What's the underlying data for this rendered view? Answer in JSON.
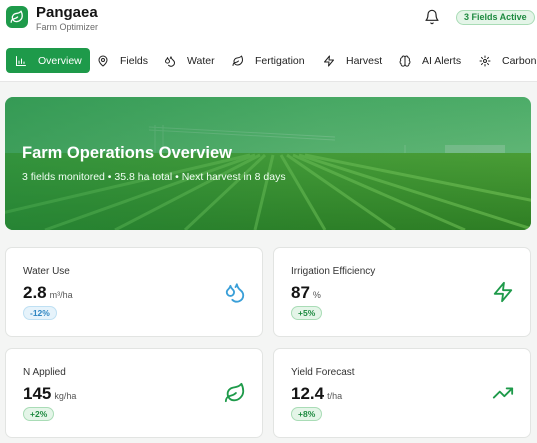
{
  "app": {
    "name": "Pangaea",
    "subtitle": "Farm Optimizer",
    "status_badge": "3 Fields Active"
  },
  "nav": {
    "items": [
      {
        "label": "Overview",
        "icon": "bar-chart-icon",
        "active": true
      },
      {
        "label": "Fields",
        "icon": "map-pin-icon"
      },
      {
        "label": "Water",
        "icon": "droplets-icon"
      },
      {
        "label": "Fertigation",
        "icon": "leaf-icon"
      },
      {
        "label": "Harvest",
        "icon": "lightning-icon"
      },
      {
        "label": "AI Alerts",
        "icon": "brain-icon"
      },
      {
        "label": "Carbon",
        "icon": "gear-icon"
      }
    ]
  },
  "hero": {
    "title": "Farm Operations Overview",
    "subtitle": "3 fields monitored • 35.8 ha total • Next harvest in 8 days"
  },
  "metrics": [
    {
      "label": "Water Use",
      "value": "2.8",
      "unit": "m³/ha",
      "change": "-12%",
      "tone": "blue",
      "icon": "droplets-icon"
    },
    {
      "label": "Irrigation Efficiency",
      "value": "87",
      "unit": "%",
      "change": "+5%",
      "tone": "green",
      "icon": "lightning-icon"
    },
    {
      "label": "N Applied",
      "value": "145",
      "unit": "kg/ha",
      "change": "+2%",
      "tone": "green",
      "icon": "leaf-icon"
    },
    {
      "label": "Yield Forecast",
      "value": "12.4",
      "unit": "t/ha",
      "change": "+8%",
      "tone": "green",
      "icon": "trending-up-icon"
    }
  ],
  "colors": {
    "brand": "#1e9a4a",
    "water": "#3a9fd8",
    "positive": "#1e8a40"
  }
}
